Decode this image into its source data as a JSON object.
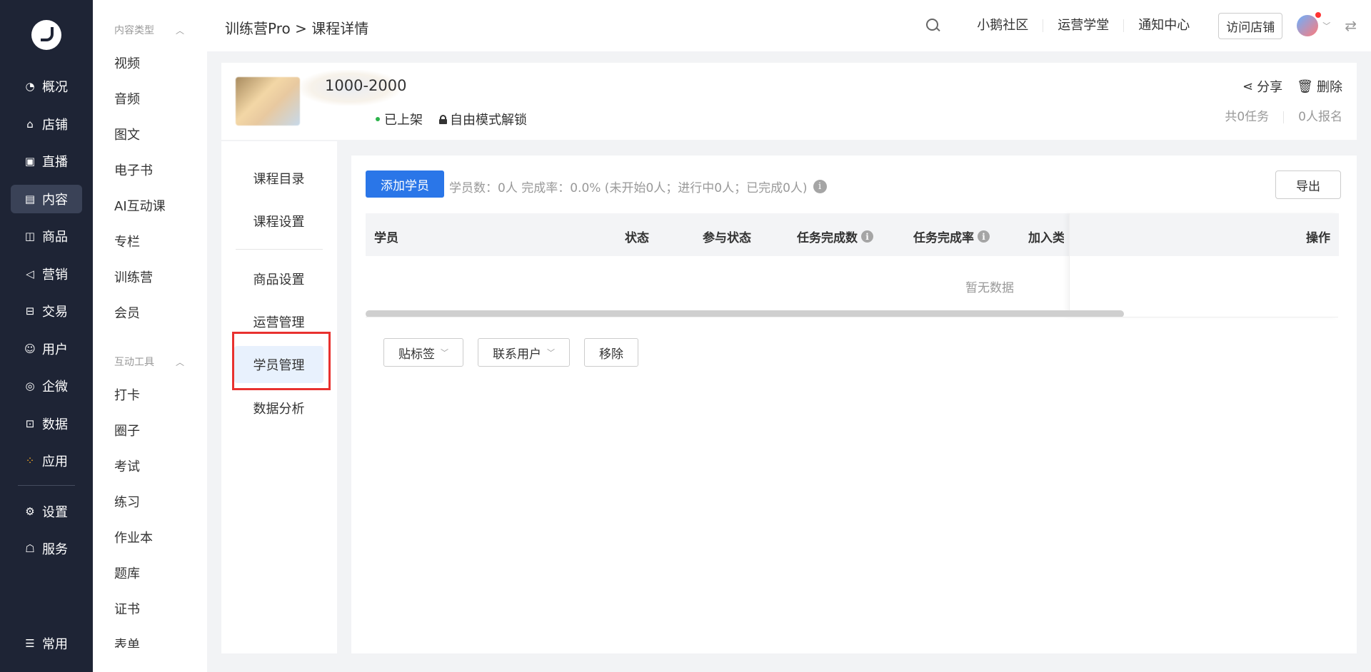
{
  "rail": {
    "items": [
      {
        "label": "概况",
        "icon": "pie-chart-icon",
        "glyph": "◔"
      },
      {
        "label": "店铺",
        "icon": "store-icon",
        "glyph": "⌂"
      },
      {
        "label": "直播",
        "icon": "live-icon",
        "glyph": "▣"
      },
      {
        "label": "内容",
        "icon": "content-icon",
        "glyph": "▤"
      },
      {
        "label": "商品",
        "icon": "goods-icon",
        "glyph": "◫"
      },
      {
        "label": "营销",
        "icon": "marketing-icon",
        "glyph": "◁"
      },
      {
        "label": "交易",
        "icon": "trade-icon",
        "glyph": "⊟"
      },
      {
        "label": "用户",
        "icon": "user-icon",
        "glyph": "☺"
      },
      {
        "label": "企微",
        "icon": "wecom-icon",
        "glyph": "◎"
      },
      {
        "label": "数据",
        "icon": "data-icon",
        "glyph": "⊡"
      },
      {
        "label": "应用",
        "icon": "apps-icon",
        "glyph": "⁘"
      },
      {
        "label": "设置",
        "icon": "settings-icon",
        "glyph": "⚙"
      },
      {
        "label": "服务",
        "icon": "service-icon",
        "glyph": "☖"
      },
      {
        "label": "常用",
        "icon": "list-icon",
        "glyph": "☰"
      }
    ]
  },
  "sidebar": {
    "group1": "内容类型",
    "group1_items": [
      "视频",
      "音频",
      "图文",
      "电子书",
      "AI互动课",
      "专栏",
      "训练营",
      "会员"
    ],
    "group2": "互动工具",
    "group2_items": [
      "打卡",
      "圈子",
      "考试",
      "练习",
      "作业本",
      "题库",
      "证书",
      "表单"
    ]
  },
  "topbar": {
    "breadcrumb": "训练营Pro > 课程详情",
    "links": [
      "小鹅社区",
      "运营学堂",
      "通知中心"
    ],
    "visit_store": "访问店铺"
  },
  "course": {
    "title": "1000-2000",
    "status": "已上架",
    "unlock_mode": "自由模式解锁",
    "share": "分享",
    "delete": "删除",
    "tasks": "共0任务",
    "enrolled": "0人报名"
  },
  "submenu": {
    "items": [
      "课程目录",
      "课程设置",
      "商品设置",
      "运营管理",
      "学员管理",
      "数据分析"
    ]
  },
  "main": {
    "add_button": "添加学员",
    "summary": "学员数：0人 完成率：0.0% (未开始0人；进行中0人；已完成0人)",
    "export": "导出",
    "columns": [
      "学员",
      "状态",
      "参与状态",
      "任务完成数",
      "任务完成率",
      "加入类型",
      "操作"
    ],
    "empty": "暂无数据",
    "bulk": {
      "tag": "贴标签",
      "contact": "联系用户",
      "remove": "移除"
    }
  },
  "colors": {
    "primary": "#2a76e8",
    "rail_bg": "#1e2435",
    "highlight": "#e8312f",
    "online": "#2bb34a"
  }
}
